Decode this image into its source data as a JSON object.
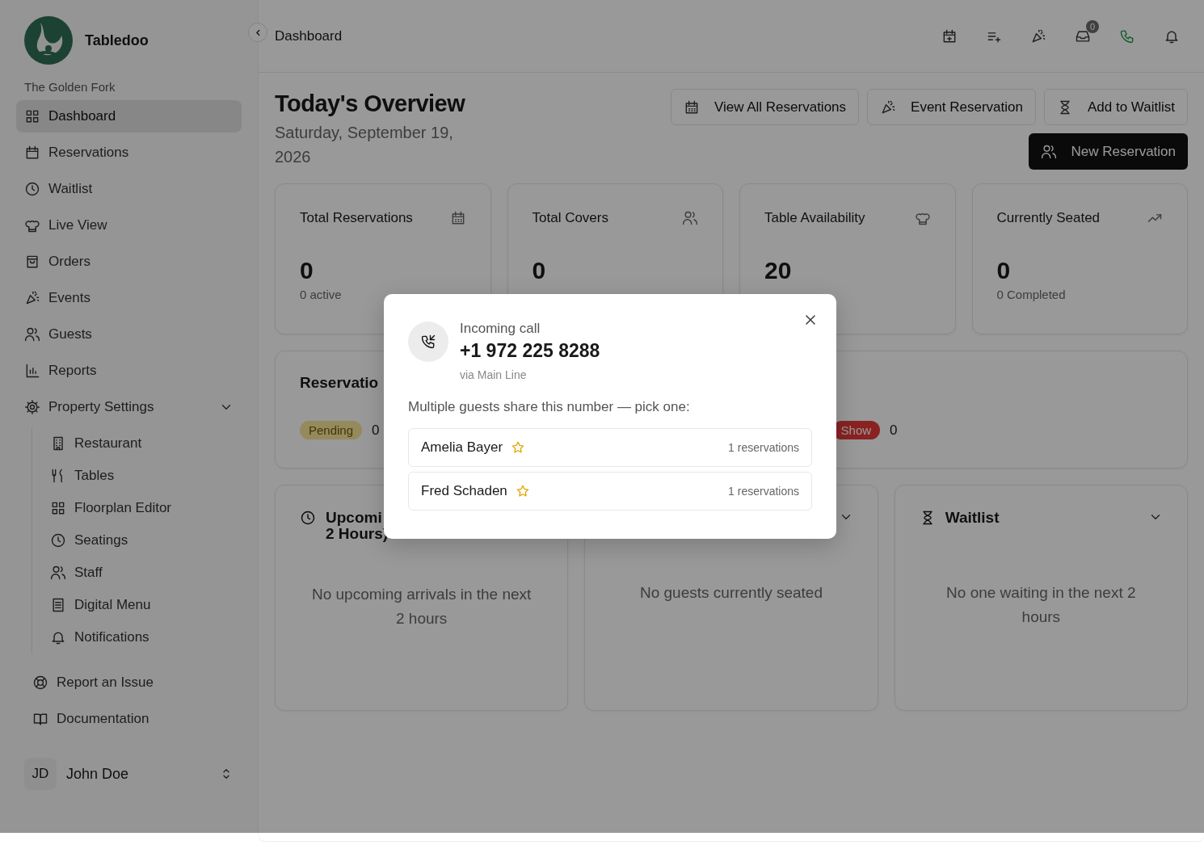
{
  "sidebar": {
    "brand": "Tabledoo",
    "property": "The Golden Fork",
    "nav": [
      {
        "label": "Dashboard",
        "selected": true
      },
      {
        "label": "Reservations",
        "selected": false
      },
      {
        "label": "Waitlist",
        "selected": false
      },
      {
        "label": "Live View",
        "selected": false
      },
      {
        "label": "Orders",
        "selected": false
      },
      {
        "label": "Events",
        "selected": false
      },
      {
        "label": "Guests",
        "selected": false
      },
      {
        "label": "Reports",
        "selected": false
      },
      {
        "label": "Property Settings",
        "selected": false,
        "expanded": true,
        "children": [
          {
            "label": "Restaurant",
            "selected": false
          },
          {
            "label": "Tables",
            "selected": false
          },
          {
            "label": "Floorplan Editor",
            "selected": false
          },
          {
            "label": "Seatings",
            "selected": false
          },
          {
            "label": "Staff",
            "selected": false
          },
          {
            "label": "Digital Menu",
            "selected": false
          },
          {
            "label": "Notifications",
            "selected": false
          }
        ]
      }
    ],
    "footer_links": [
      "Report an Issue",
      "Documentation"
    ],
    "user": {
      "initials": "JD",
      "name": "John Doe"
    }
  },
  "topbar": {
    "title": "Dashboard",
    "inbox_count": "0"
  },
  "overview": {
    "title": "Today's Overview",
    "date": "Saturday, September 19, 2026",
    "actions": [
      "View All Reservations",
      "Event Reservation",
      "Add to Waitlist"
    ],
    "primary_action": "New Reservation"
  },
  "stats": [
    {
      "title": "Total Reservations",
      "value": "0",
      "note": "0 active"
    },
    {
      "title": "Total Covers",
      "value": "0"
    },
    {
      "title": "Table Availability",
      "value": "20"
    },
    {
      "title": "Currently Seated",
      "value": "0",
      "note": "0 Completed"
    }
  ],
  "status_card": {
    "title": "Reservatio",
    "badges": [
      {
        "label": "Pending",
        "count": "0",
        "color": "#958a5c"
      },
      {
        "label": "Show",
        "count": "0",
        "color": "#8a2323"
      }
    ]
  },
  "panels": [
    {
      "title_lines": [
        "Upcomi",
        "2 Hours)"
      ],
      "chevron": false,
      "empty": "No upcoming arrivals in the next 2 hours"
    },
    {
      "chevron": true,
      "empty": "No guests currently seated"
    },
    {
      "title_lines": [
        "Waitlist"
      ],
      "chevron": true,
      "empty": "No one waiting in the next 2 hours"
    }
  ],
  "call_dialog": {
    "heading": "Incoming call",
    "number": "+1 972 225 8288",
    "via": "via Main Line",
    "prompt": "Multiple guests share this number — pick one:",
    "guests": [
      {
        "name": "Amelia Bayer",
        "vip": true,
        "count": "1 reservations"
      },
      {
        "name": "Fred Schaden",
        "vip": true,
        "count": "1 reservations"
      }
    ]
  }
}
